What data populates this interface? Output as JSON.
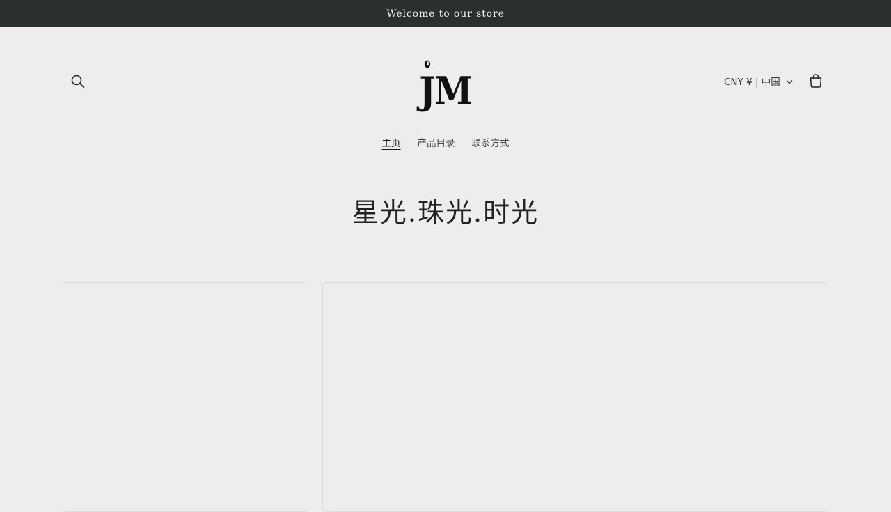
{
  "announcement": {
    "text": "Welcome to our store"
  },
  "header": {
    "logo_text": "JM",
    "currency_label": "CNY ¥ | 中国",
    "icons": {
      "search": "search-icon",
      "cart": "cart-icon",
      "currency_chevron": "chevron-down-icon"
    }
  },
  "nav": {
    "items": [
      {
        "label": "主页",
        "active": true
      },
      {
        "label": "产品目录",
        "active": false
      },
      {
        "label": "联系方式",
        "active": false
      }
    ]
  },
  "hero": {
    "title": "星光.珠光.时光"
  },
  "colors": {
    "announcement_bg": "#2b302e",
    "page_bg": "#eeedeb",
    "text": "#2a2a2a"
  }
}
